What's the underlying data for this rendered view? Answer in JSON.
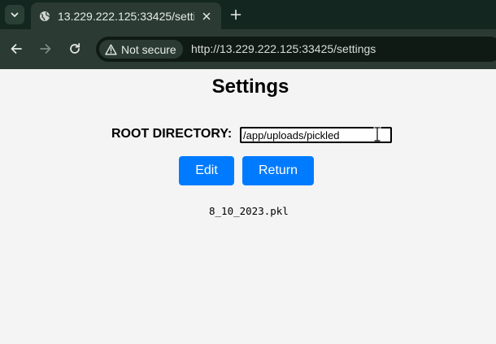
{
  "browser": {
    "tab_title": "13.229.222.125:33425/settings",
    "security_label": "Not secure",
    "url": "http://13.229.222.125:33425/settings"
  },
  "page": {
    "title": "Settings",
    "root_label": "ROOT DIRECTORY:",
    "root_value": "/app/uploads/pickled",
    "edit_label": "Edit",
    "return_label": "Return",
    "files": [
      "8_10_2023.pkl"
    ]
  },
  "colors": {
    "primary_button": "#007bff",
    "page_background": "#f4f4f4",
    "chrome_background": "#2b3b33"
  },
  "icons": {
    "tab_list": "chevron-down-icon",
    "favicon": "globe-icon",
    "tab_close": "close-icon",
    "new_tab": "plus-icon",
    "back": "arrow-left-icon",
    "forward": "arrow-right-icon",
    "reload": "reload-icon",
    "security": "warning-icon",
    "cursor": "text-cursor-icon"
  }
}
